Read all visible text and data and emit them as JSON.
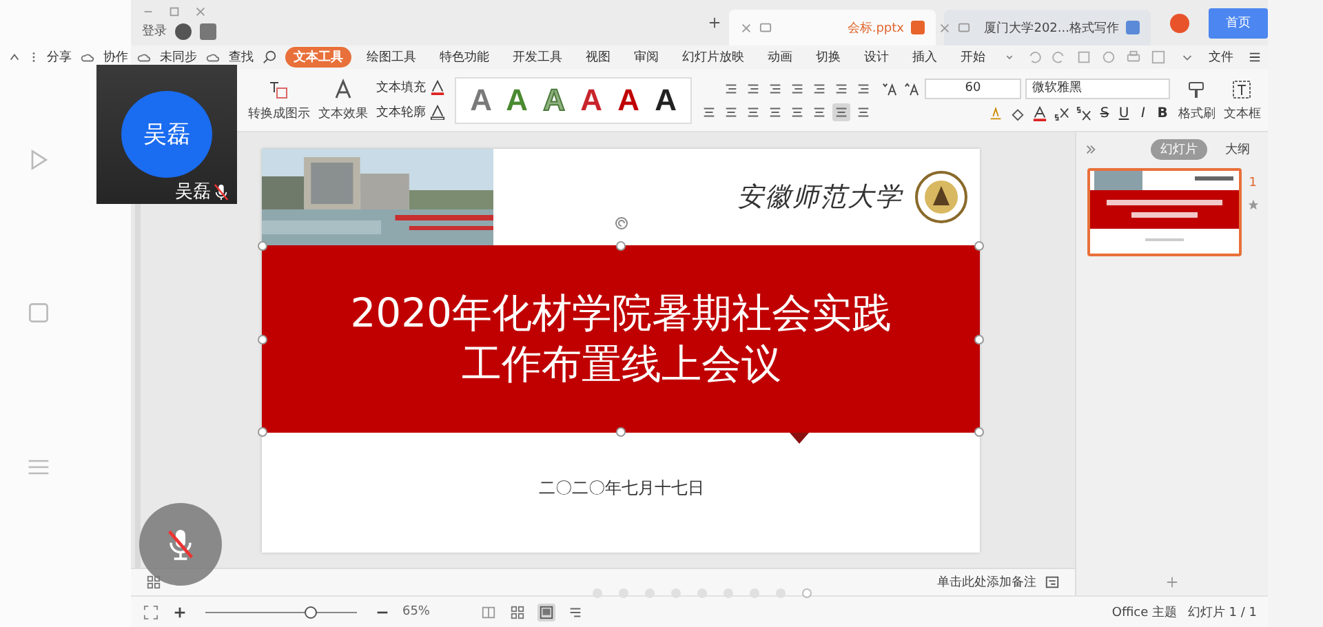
{
  "app": {
    "tabs": [
      {
        "label": "会标.pptx",
        "kind": "ppt",
        "selected": true
      },
      {
        "label": "厦门大学202...格式写作",
        "kind": "doc",
        "selected": false
      },
      {
        "label": "首页",
        "kind": "home",
        "selected": false
      }
    ],
    "account": {
      "label": "登录"
    },
    "file_menu": "文件",
    "menu": [
      {
        "label": "文本工具",
        "selected": true
      },
      {
        "label": "绘图工具",
        "selected": false
      },
      {
        "label": "特色功能",
        "selected": false
      },
      {
        "label": "开发工具",
        "selected": false
      },
      {
        "label": "视图",
        "selected": false
      },
      {
        "label": "审阅",
        "selected": false
      },
      {
        "label": "幻灯片放映",
        "selected": false
      },
      {
        "label": "动画",
        "selected": false
      },
      {
        "label": "切换",
        "selected": false
      },
      {
        "label": "设计",
        "selected": false
      },
      {
        "label": "插入",
        "selected": false
      },
      {
        "label": "开始",
        "selected": false
      }
    ],
    "quick_actions": [
      "分享",
      "协作",
      "未同步",
      "查找"
    ],
    "ribbon": {
      "text_box": "文本框",
      "format_painter": "格式刷",
      "font": "微软雅黑",
      "size": "60",
      "format_buttons": [
        "S",
        "U",
        "I",
        "B"
      ],
      "gallery": [
        {
          "letter": "A",
          "color": "#7a7a7a"
        },
        {
          "letter": "A",
          "color": "#4a8a30"
        },
        {
          "letter": "A",
          "color": "#8fb07f"
        },
        {
          "letter": "A",
          "color": "#c8242c"
        },
        {
          "letter": "A",
          "color": "#c00000"
        },
        {
          "letter": "A",
          "color": "#222222"
        }
      ],
      "text_fill": "文本填充",
      "text_outline": "文本轮廓",
      "text_effect": "文本效果",
      "convert": "转换成图示"
    },
    "panel_tabs": [
      {
        "label": "幻灯片",
        "selected": true
      },
      {
        "label": "大纲",
        "selected": false
      }
    ],
    "thumbnails": [
      {
        "number": "1",
        "selected": true
      }
    ],
    "slide": {
      "school": "安徽师范大学",
      "title_lines": [
        "2020年化材学院暑期社会实践",
        "工作布置线上会议"
      ],
      "date": "二〇二〇年七月十七日"
    },
    "notes_placeholder": "单击此处添加备注",
    "status": {
      "slide_count": "幻灯片 1 / 1",
      "theme": "Office 主题",
      "zoom": "65%",
      "level": 0.69
    }
  },
  "call": {
    "participant": {
      "avatar": "吴磊",
      "name": "吴磊",
      "muted": true
    },
    "mic_muted": true,
    "pages": [
      {
        "selected": false
      },
      {
        "selected": false
      },
      {
        "selected": false
      },
      {
        "selected": false
      },
      {
        "selected": false
      },
      {
        "selected": false
      },
      {
        "selected": false
      },
      {
        "selected": false
      },
      {
        "selected": true
      }
    ]
  }
}
